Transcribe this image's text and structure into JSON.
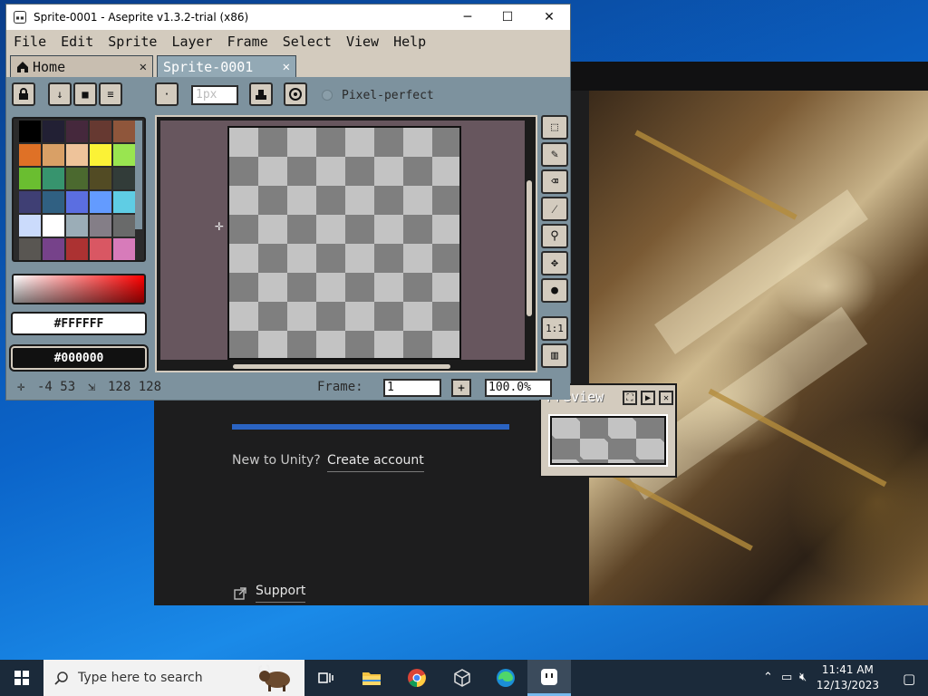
{
  "unity": {
    "new_to_unity": "New to Unity?",
    "create_account": "Create account",
    "support": "Support"
  },
  "aseprite": {
    "window_title": "Sprite-0001 - Aseprite v1.3.2-trial (x86)",
    "controls": {
      "minimize": "─",
      "maximize": "☐",
      "close": "✕"
    },
    "menu": [
      "File",
      "Edit",
      "Sprite",
      "Layer",
      "Frame",
      "Select",
      "View",
      "Help"
    ],
    "tabs": {
      "home": "Home",
      "sprite": "Sprite-0001",
      "close": "✕"
    },
    "toolbar": {
      "brush_size_placeholder": "1px",
      "pixel_perfect": "Pixel-perfect"
    },
    "palette": [
      "#000000",
      "#222034",
      "#45283c",
      "#663931",
      "#8f563b",
      "#df7126",
      "#d9a066",
      "#eec39a",
      "#fbf236",
      "#99e550",
      "#6abe30",
      "#37946e",
      "#4b692f",
      "#524b24",
      "#323c39",
      "#3f3f74",
      "#306082",
      "#5b6ee1",
      "#639bff",
      "#5fcde4",
      "#cbdbfc",
      "#ffffff",
      "#9badb7",
      "#847e87",
      "#696a6a",
      "#595652",
      "#76428a",
      "#ac3232",
      "#d95763",
      "#d77bba"
    ],
    "fg_color": "#FFFFFF",
    "bg_color": "#000000",
    "preview_title": "Preview",
    "status": {
      "position": "-4 53",
      "size": "128 128",
      "frame_label": "Frame:",
      "frame_value": "1",
      "zoom_value": "100.0%"
    },
    "tools": [
      "marquee-tool",
      "pencil-tool",
      "eraser-tool",
      "eyedropper-tool",
      "zoom-tool",
      "move-tool",
      "fill-tool",
      "pixel-ratio-tool",
      "timeline-tool"
    ],
    "pixel_ratio_label": "1:1"
  },
  "taskbar": {
    "search_placeholder": "Type here to search",
    "time": "11:41 AM",
    "date": "12/13/2023"
  }
}
